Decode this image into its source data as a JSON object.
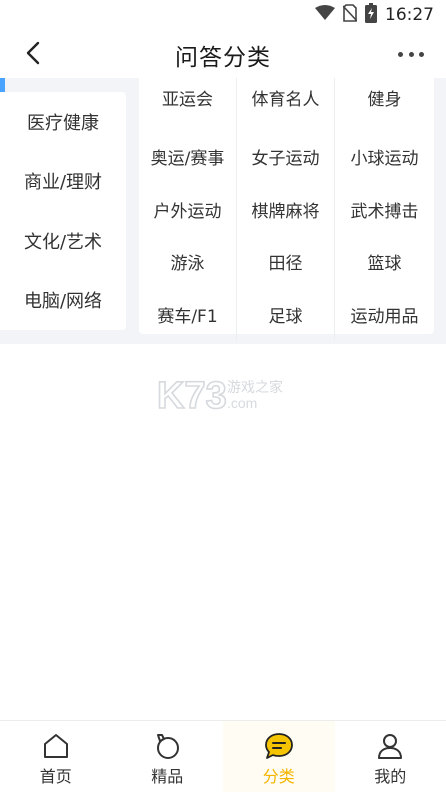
{
  "status_bar": {
    "time": "16:27",
    "icons": [
      "wifi-icon",
      "no-sim-icon",
      "battery-charging-icon"
    ]
  },
  "header": {
    "title": "问答分类",
    "back_icon": "chevron-left-icon",
    "more_icon": "more-dots-icon"
  },
  "sidebar": {
    "items": [
      {
        "label": "医疗健康"
      },
      {
        "label": "商业/理财"
      },
      {
        "label": "文化/艺术"
      },
      {
        "label": "电脑/网络"
      }
    ]
  },
  "subcategories": {
    "items": [
      {
        "label": "亚运会"
      },
      {
        "label": "体育名人"
      },
      {
        "label": "健身"
      },
      {
        "label": "奥运/赛事"
      },
      {
        "label": "女子运动"
      },
      {
        "label": "小球运动"
      },
      {
        "label": "户外运动"
      },
      {
        "label": "棋牌麻将"
      },
      {
        "label": "武术搏击"
      },
      {
        "label": "游泳"
      },
      {
        "label": "田径"
      },
      {
        "label": "篮球"
      },
      {
        "label": "赛车/F1"
      },
      {
        "label": "足球"
      },
      {
        "label": "运动用品"
      }
    ]
  },
  "watermark": {
    "brand": "K73",
    "site_text": "游戏之家",
    "domain_text": ".com"
  },
  "bottom_nav": {
    "items": [
      {
        "label": "首页",
        "icon": "home-icon"
      },
      {
        "label": "精品",
        "icon": "featured-icon"
      },
      {
        "label": "分类",
        "icon": "chat-category-icon",
        "active": true
      },
      {
        "label": "我的",
        "icon": "user-icon"
      }
    ]
  },
  "colors": {
    "accent": "#f5b400",
    "sidebar_indicator": "#4aa3ff",
    "content_background": "#f2f4f7"
  }
}
